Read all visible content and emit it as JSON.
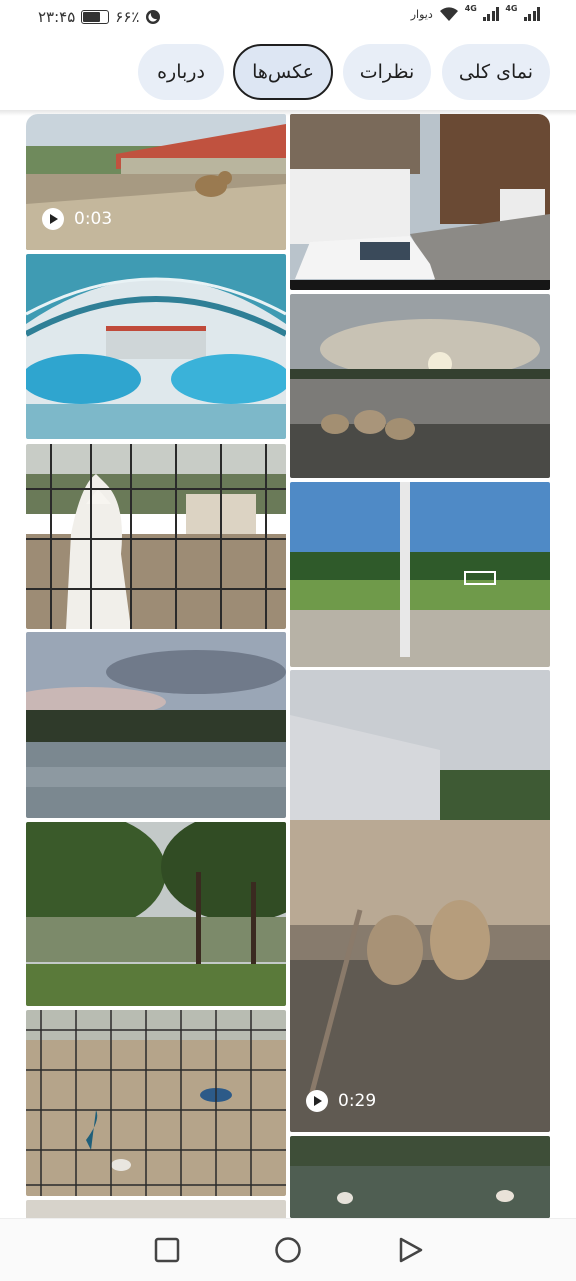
{
  "status_bar": {
    "time": "۲۳:۴۵",
    "battery_percent": "۶۶٪",
    "battery_level": 0.66,
    "carrier": "دیوار",
    "network_1": "4G",
    "network_2": "4G"
  },
  "tabs": [
    {
      "label": "نمای کلی",
      "active": false
    },
    {
      "label": "نظرات",
      "active": false
    },
    {
      "label": "عکس‌ها",
      "active": true
    },
    {
      "label": "درباره",
      "active": false
    }
  ],
  "photos": {
    "video_1_duration": "0:03",
    "video_2_duration": "0:29"
  },
  "nav": {
    "recents": "recent-apps-icon",
    "home": "home-icon",
    "back": "back-icon"
  }
}
